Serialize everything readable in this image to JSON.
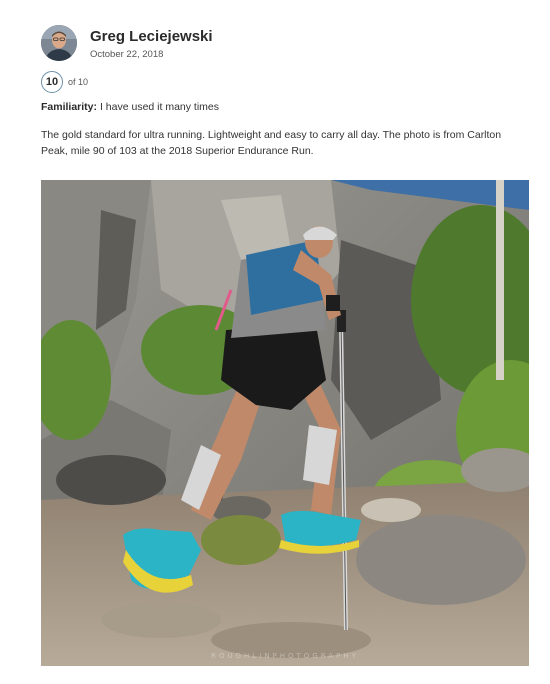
{
  "review": {
    "author": {
      "name": "Greg Leciejewski",
      "avatar_icon": "user-avatar-photo"
    },
    "date": "October 22, 2018",
    "score": {
      "value": "10",
      "max_label": "of 10"
    },
    "familiarity": {
      "label": "Familiarity:",
      "value": "I have used it many times"
    },
    "body": "The gold standard for ultra running.  Lightweight and easy to carry all day.  The photo is from Carlton Peak, mile 90 of 103 at the 2018 Superior Endurance Run.",
    "photo": {
      "subject": "trail runner with hydration vest and trekking poles climbing rocky trail",
      "watermark": "ROUGHLINPHOTOGRAPHY"
    }
  },
  "colors": {
    "score_ring": "#6b8fa8",
    "text": "#333333",
    "name": "#2b2b2b"
  }
}
